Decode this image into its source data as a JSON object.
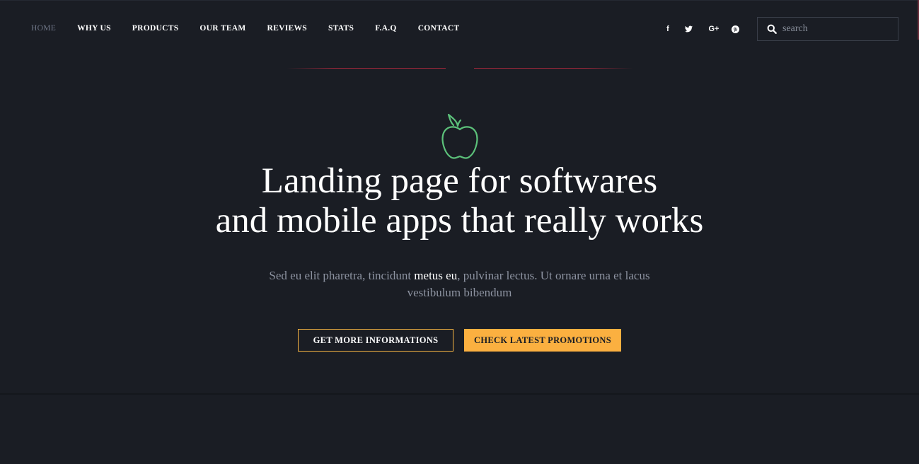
{
  "nav": {
    "items": [
      {
        "label": "HOME",
        "active": true
      },
      {
        "label": "WHY US"
      },
      {
        "label": "PRODUCTS"
      },
      {
        "label": "OUR TEAM"
      },
      {
        "label": "REVIEWS"
      },
      {
        "label": "STATS"
      },
      {
        "label": "F.A.Q"
      },
      {
        "label": "CONTACT"
      }
    ]
  },
  "social": {
    "icons": [
      "facebook-icon",
      "twitter-icon",
      "google-plus-icon",
      "pinterest-icon"
    ],
    "facebook_glyph": "f",
    "google_glyph": "G+"
  },
  "search": {
    "placeholder": "search",
    "value": ""
  },
  "hero": {
    "headline_line1": "Landing page for softwares",
    "headline_line2": "and mobile apps that really works",
    "subtext_before": "Sed eu elit pharetra, tincidunt ",
    "subtext_highlight": "metus eu",
    "subtext_after": ", pulvinar lectus. Ut ornare urna et lacus vestibulum bibendum",
    "icon": "apple-icon"
  },
  "buttons": {
    "primary_label": "GET MORE INFORMATIONS",
    "secondary_label": "CHECK LATEST PROMOTIONS"
  },
  "colors": {
    "background": "#1a1d24",
    "accent_yellow": "#fbb040",
    "accent_red": "#a0283c",
    "icon_green": "#5cc17a",
    "muted_text": "#8d93a1",
    "nav_active": "#6e7586"
  }
}
